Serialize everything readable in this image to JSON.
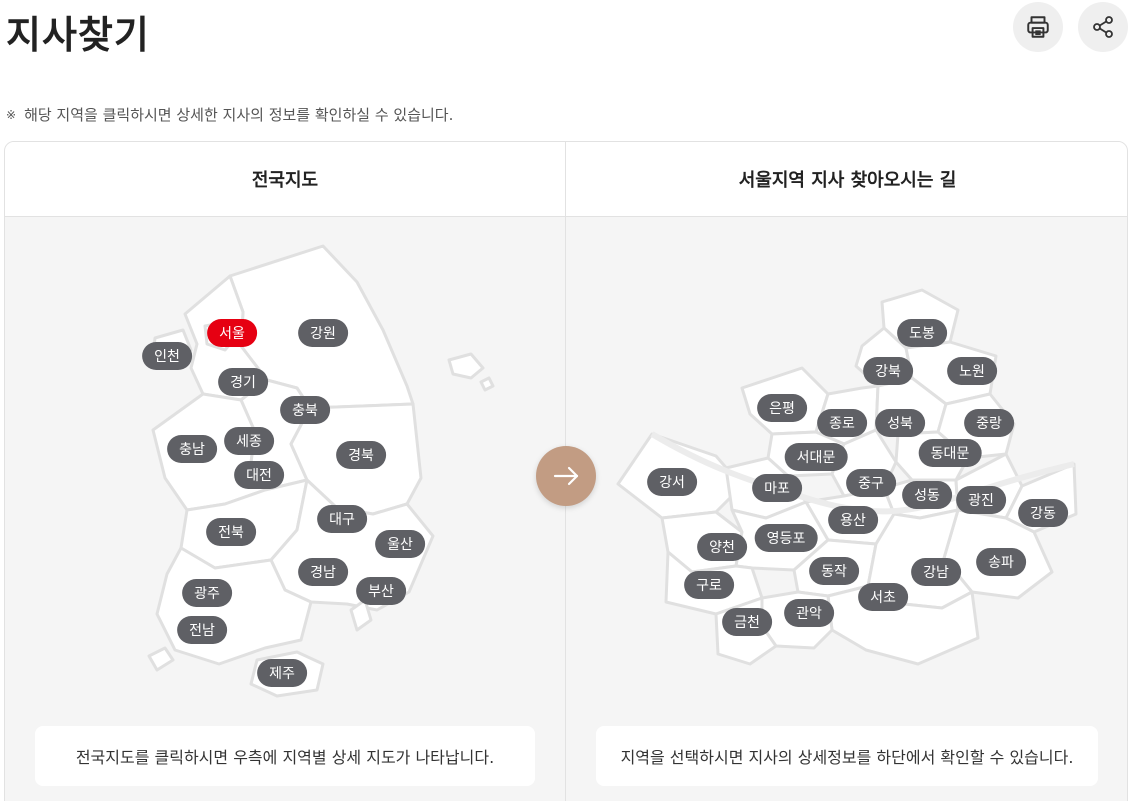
{
  "page": {
    "title": "지사찾기",
    "notice_mark": "※",
    "notice": "해당 지역을 클릭하시면 상세한 지사의 정보를 확인하실 수 있습니다."
  },
  "toolbar": {
    "print_icon": "printer-icon",
    "share_icon": "share-icon"
  },
  "left_panel": {
    "header": "전국지도",
    "info": "전국지도를 클릭하시면 우측에 지역별 상세 지도가 나타납니다.",
    "regions": [
      {
        "name": "서울",
        "active": true
      },
      {
        "name": "강원",
        "active": false
      },
      {
        "name": "인천",
        "active": false
      },
      {
        "name": "경기",
        "active": false
      },
      {
        "name": "충북",
        "active": false
      },
      {
        "name": "세종",
        "active": false
      },
      {
        "name": "충남",
        "active": false
      },
      {
        "name": "경북",
        "active": false
      },
      {
        "name": "대전",
        "active": false
      },
      {
        "name": "대구",
        "active": false
      },
      {
        "name": "전북",
        "active": false
      },
      {
        "name": "울산",
        "active": false
      },
      {
        "name": "경남",
        "active": false
      },
      {
        "name": "부산",
        "active": false
      },
      {
        "name": "광주",
        "active": false
      },
      {
        "name": "전남",
        "active": false
      },
      {
        "name": "제주",
        "active": false
      }
    ]
  },
  "right_panel": {
    "header": "서울지역 지사 찾아오시는 길",
    "info": "지역을 선택하시면 지사의 상세정보를 하단에서 확인할 수 있습니다.",
    "districts": [
      {
        "name": "도봉"
      },
      {
        "name": "강북"
      },
      {
        "name": "노원"
      },
      {
        "name": "은평"
      },
      {
        "name": "종로"
      },
      {
        "name": "성북"
      },
      {
        "name": "중랑"
      },
      {
        "name": "서대문"
      },
      {
        "name": "동대문"
      },
      {
        "name": "강서"
      },
      {
        "name": "마포"
      },
      {
        "name": "중구"
      },
      {
        "name": "성동"
      },
      {
        "name": "광진"
      },
      {
        "name": "강동"
      },
      {
        "name": "용산"
      },
      {
        "name": "양천"
      },
      {
        "name": "영등포"
      },
      {
        "name": "송파"
      },
      {
        "name": "동작"
      },
      {
        "name": "강남"
      },
      {
        "name": "구로"
      },
      {
        "name": "서초"
      },
      {
        "name": "관악"
      },
      {
        "name": "금천"
      }
    ]
  },
  "colors": {
    "active": "#e60012",
    "label": "#5f6065",
    "arrow": "#c29c83",
    "map_fill": "#ffffff",
    "map_stroke": "#e0e0e0",
    "panel_bg": "#f5f5f5"
  },
  "arrow_icon": "arrow-right-icon"
}
